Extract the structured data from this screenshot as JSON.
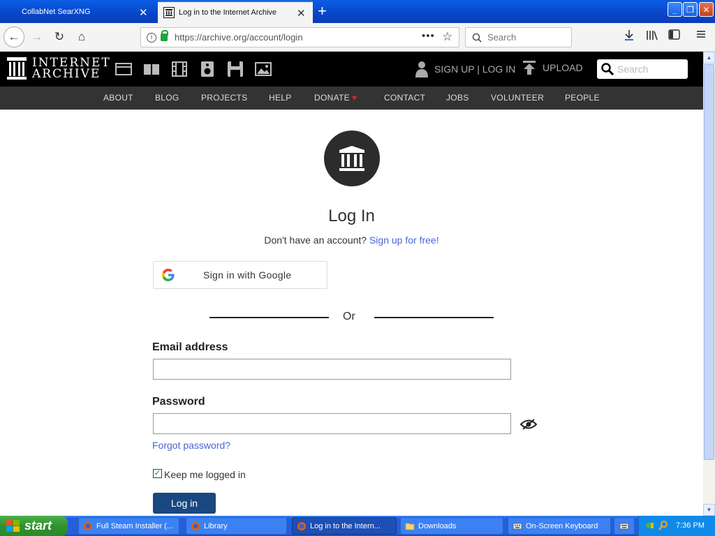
{
  "browser": {
    "tabs": [
      {
        "label": "CollabNet SearXNG",
        "active": false
      },
      {
        "label": "Log in to the Internet Archive",
        "active": true
      }
    ],
    "url": "https://archive.org/account/login",
    "search_placeholder": "Search"
  },
  "ia_header": {
    "logo_line1": "INTERNET",
    "logo_line2": "ARCHIVE",
    "media_icons": [
      "web-icon",
      "texts-icon",
      "video-icon",
      "audio-icon",
      "software-icon",
      "images-icon"
    ],
    "user_links": "SIGN UP | LOG IN",
    "upload_label": "UPLOAD",
    "search_placeholder": "Search"
  },
  "ia_nav": {
    "items": [
      "ABOUT",
      "BLOG",
      "PROJECTS",
      "HELP",
      "DONATE",
      "CONTACT",
      "JOBS",
      "VOLUNTEER",
      "PEOPLE"
    ]
  },
  "login": {
    "title": "Log In",
    "no_account_text": "Don't have an account?",
    "signup_link": "Sign up for free!",
    "google_button": "Sign in with Google",
    "or_text": "Or",
    "email_label": "Email address",
    "email_value": "",
    "password_label": "Password",
    "password_value": "",
    "forgot_link": "Forgot password?",
    "keep_logged_in_label": "Keep me logged in",
    "keep_logged_in_checked": true,
    "submit_label": "Log in"
  },
  "taskbar": {
    "start_label": "start",
    "tasks": [
      {
        "label": "Full Steam Installer (...",
        "active": false
      },
      {
        "label": "Library",
        "active": false
      },
      {
        "label": "Log in to the Intern...",
        "active": true
      },
      {
        "label": "Downloads",
        "active": false
      },
      {
        "label": "On-Screen Keyboard",
        "active": false
      }
    ],
    "clock": "7:36 PM"
  },
  "colors": {
    "accent_link": "#4b64d6",
    "login_button": "#194880",
    "donate_heart": "#e0202c",
    "xp_blue": "#245edb"
  }
}
